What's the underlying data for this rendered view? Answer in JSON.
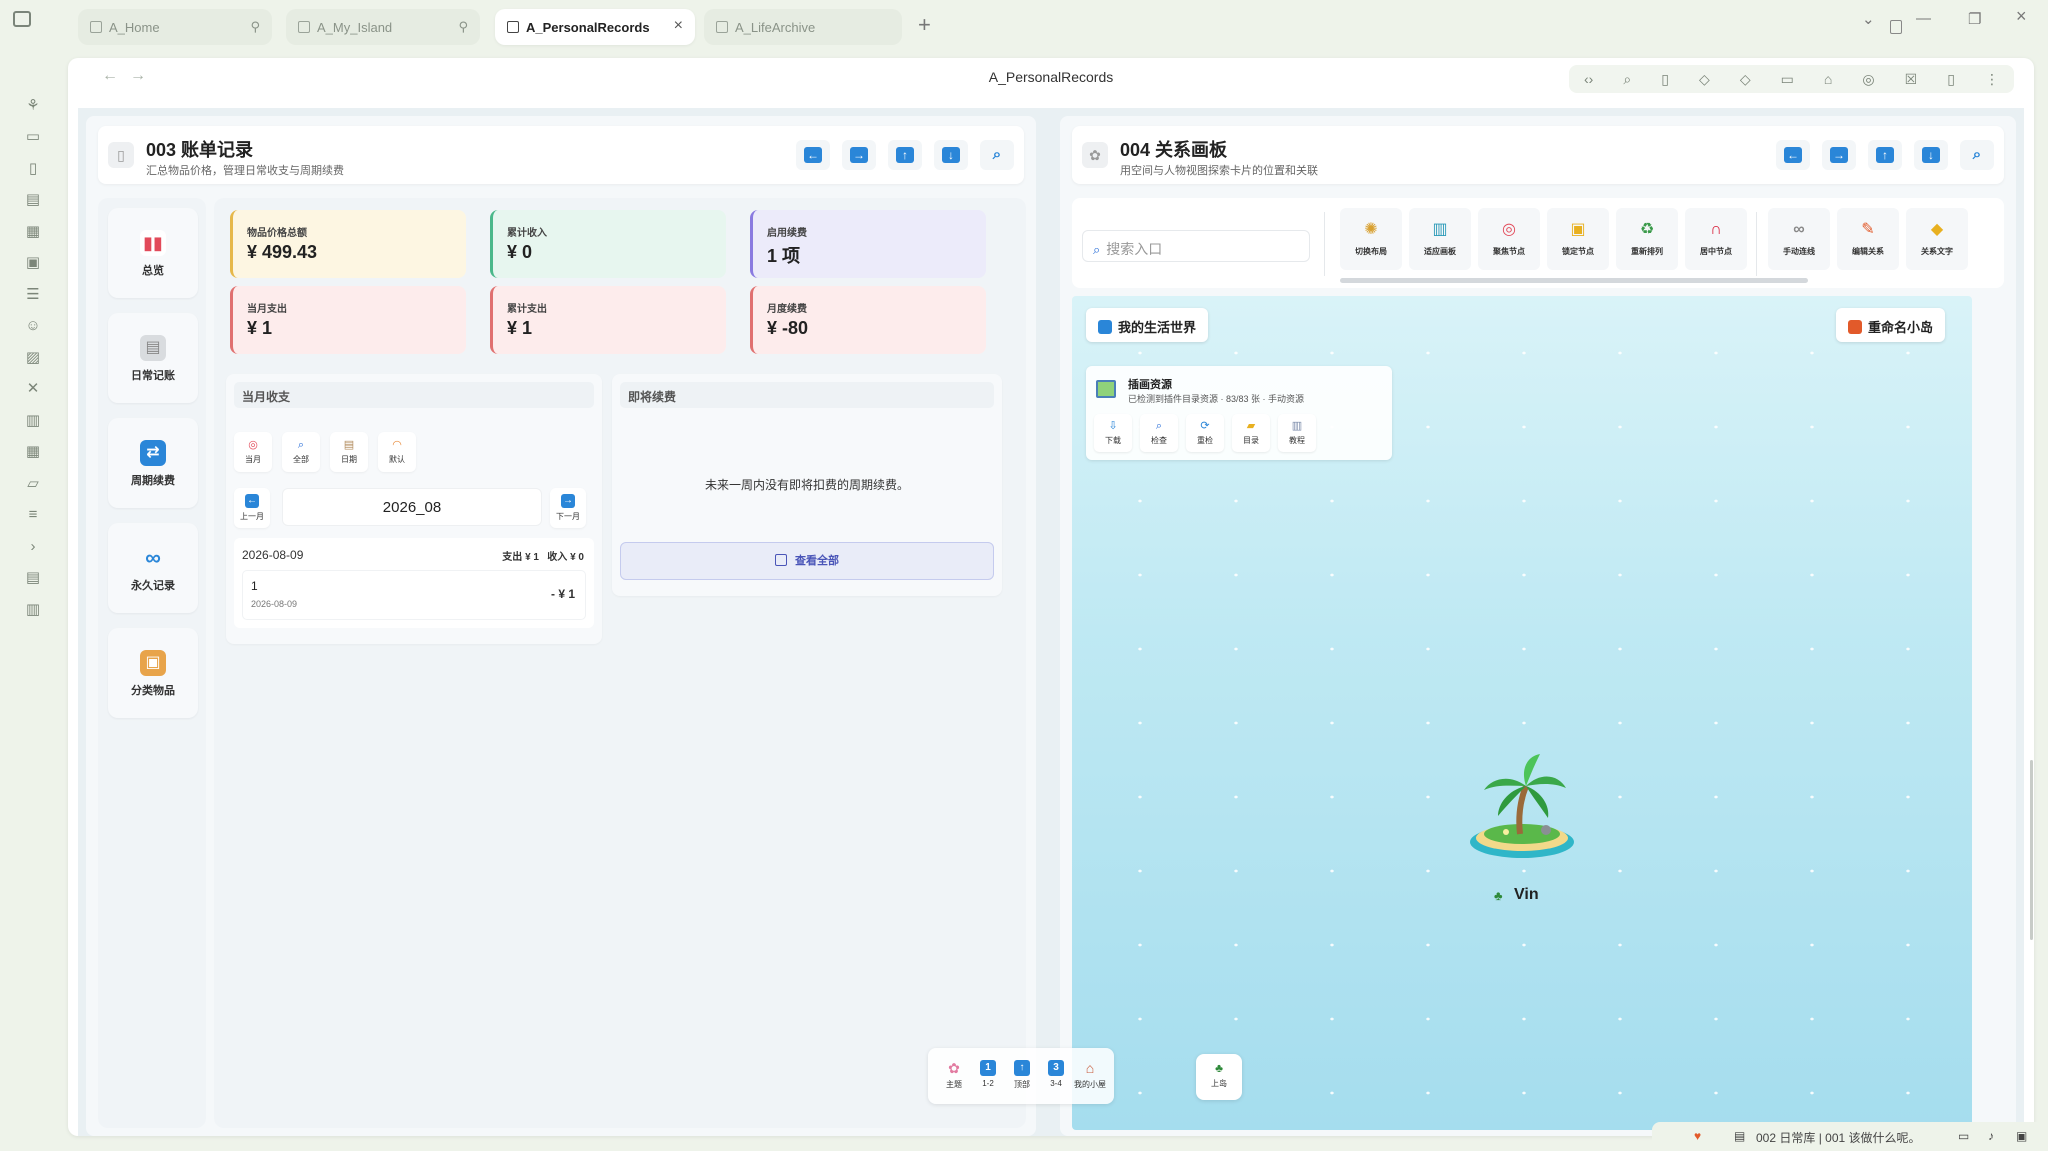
{
  "tabs": [
    {
      "label": "A_Home",
      "pinned": true
    },
    {
      "label": "A_My_Island",
      "pinned": true
    },
    {
      "label": "A_PersonalRecords",
      "active": true
    },
    {
      "label": "A_LifeArchive"
    }
  ],
  "window": {
    "title": "A_PersonalRecords"
  },
  "left_pane": {
    "title": "003 账单记录",
    "subtitle": "汇总物品价格，管理日常收支与周期续费",
    "side_nav": [
      {
        "label": "总览",
        "icon": "bar-chart-icon"
      },
      {
        "label": "日常记账",
        "icon": "notebook-icon"
      },
      {
        "label": "周期续费",
        "icon": "repeat-icon"
      },
      {
        "label": "永久记录",
        "icon": "infinity-icon"
      },
      {
        "label": "分类物品",
        "icon": "box-icon"
      }
    ],
    "stats": [
      {
        "label": "物品价格总额",
        "value": "¥ 499.43",
        "color": "yellow"
      },
      {
        "label": "累计收入",
        "value": "¥ 0",
        "color": "green"
      },
      {
        "label": "启用续费",
        "value": "1 项",
        "color": "purple"
      },
      {
        "label": "当月支出",
        "value": "¥ 1",
        "color": "red"
      },
      {
        "label": "累计支出",
        "value": "¥ 1",
        "color": "red"
      },
      {
        "label": "月度续费",
        "value": "¥ -80",
        "color": "red"
      }
    ],
    "monthly": {
      "header": "当月收支",
      "filters": [
        {
          "label": "当月",
          "icon": "target-icon"
        },
        {
          "label": "全部",
          "icon": "magnifier-icon"
        },
        {
          "label": "日期",
          "icon": "clipboard-icon"
        },
        {
          "label": "默认",
          "icon": "rainbow-icon"
        }
      ],
      "prev_label": "上一月",
      "next_label": "下一月",
      "month": "2026_08",
      "records": [
        {
          "date": "2026-08-09",
          "summary": "支出 ¥ 1   收入 ¥ 0",
          "items": [
            {
              "name": "1",
              "date": "2026-08-09",
              "amount": "- ¥ 1"
            }
          ]
        }
      ]
    },
    "upcoming": {
      "header": "即将续费",
      "empty_text": "未来一周内没有即将扣费的周期续费。",
      "view_all": "查看全部"
    }
  },
  "right_pane": {
    "title": "004 关系画板",
    "subtitle": "用空间与人物视图探索卡片的位置和关联",
    "search_placeholder": "搜索入口",
    "tools": [
      {
        "label": "切换布局",
        "icon": "compass-icon"
      },
      {
        "label": "适应画板",
        "icon": "book-icon"
      },
      {
        "label": "聚焦节点",
        "icon": "target-icon"
      },
      {
        "label": "锁定节点",
        "icon": "lock-icon"
      },
      {
        "label": "重新排列",
        "icon": "recycle-icon"
      },
      {
        "label": "居中节点",
        "icon": "magnet-icon"
      },
      {
        "label": "手动连线",
        "icon": "link-icon"
      },
      {
        "label": "编辑关系",
        "icon": "pencil-icon"
      },
      {
        "label": "关系文字",
        "icon": "tag-icon"
      }
    ],
    "world_chip": "我的生活世界",
    "rename_chip": "重命名小岛",
    "assets": {
      "title": "插画资源",
      "subtitle": "已检测到插件目录资源 · 83/83 张 · 手动资源",
      "buttons": [
        {
          "label": "下载",
          "icon": "download-icon"
        },
        {
          "label": "检查",
          "icon": "magnifier-icon"
        },
        {
          "label": "重检",
          "icon": "refresh-icon"
        },
        {
          "label": "目录",
          "icon": "folder-icon"
        },
        {
          "label": "教程",
          "icon": "book-icon"
        }
      ]
    },
    "island_label": "Vin"
  },
  "dock": [
    {
      "label": "主题",
      "icon": "flower-icon"
    },
    {
      "label": "1-2",
      "icon": "one-icon",
      "glyph": "1"
    },
    {
      "label": "顶部",
      "icon": "arrow-up-icon",
      "glyph": "↑"
    },
    {
      "label": "3-4",
      "icon": "three-icon",
      "glyph": "3"
    },
    {
      "label": "我的小屋",
      "icon": "house-icon"
    }
  ],
  "dock_island": {
    "label": "上岛",
    "icon": "palm-icon"
  },
  "status": {
    "text": "002 日常库 | 001 该做什么呢。"
  },
  "colors": {
    "accent": "#2a86d8",
    "canvas": "#bfe9f3",
    "background": "#eef3ea"
  }
}
